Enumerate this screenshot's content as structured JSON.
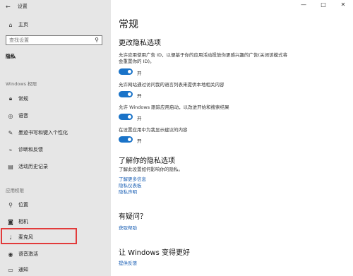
{
  "window": {
    "title": "设置",
    "controls": [
      "—",
      "□",
      "✕"
    ]
  },
  "sidebar": {
    "home": "主页",
    "search_placeholder": "查找设置",
    "current": "隐私",
    "windows_section": "Windows 权限",
    "windows_items": [
      {
        "icon": "lock-icon",
        "label": "常规"
      },
      {
        "icon": "mic-icon",
        "label": "语音"
      },
      {
        "icon": "pen-icon",
        "label": "墨迹书写和键入个性化"
      },
      {
        "icon": "diagnostics-icon",
        "label": "诊断和反馈"
      },
      {
        "icon": "history-icon",
        "label": "活动历史记录"
      }
    ],
    "app_section": "应用权限",
    "app_items": [
      {
        "icon": "location-icon",
        "label": "位置"
      },
      {
        "icon": "camera-icon",
        "label": "相机"
      },
      {
        "icon": "microphone-icon",
        "label": "麦克风"
      },
      {
        "icon": "voice-activation-icon",
        "label": "语音激活"
      },
      {
        "icon": "notification-icon",
        "label": "通知"
      }
    ]
  },
  "main": {
    "title": "常规",
    "section1": "更改隐私选项",
    "options": [
      {
        "desc": "允许应用使用广告 ID，以便基于你的应用活动投放你更感兴趣的广告(关闭该模式将会重置你的 ID)。",
        "state": "开"
      },
      {
        "desc": "允许网站通过访问我的语言列表来提供本地相关内容",
        "state": "开"
      },
      {
        "desc": "允许 Windows 跟踪应用启动，以改进开始和搜索结果",
        "state": "开"
      },
      {
        "desc": "在设置应用中为我显示建议的内容",
        "state": "开"
      }
    ],
    "know_title": "了解你的隐私选项",
    "know_desc": "了解此设置如何影响你的隐私。",
    "know_links": [
      "了解更多信息",
      "隐私仪表板",
      "隐私声明"
    ],
    "question_title": "有疑问？",
    "help_link": "获取帮助",
    "improve_title": "让 Windows 变得更好",
    "feedback_link": "提供反馈"
  }
}
